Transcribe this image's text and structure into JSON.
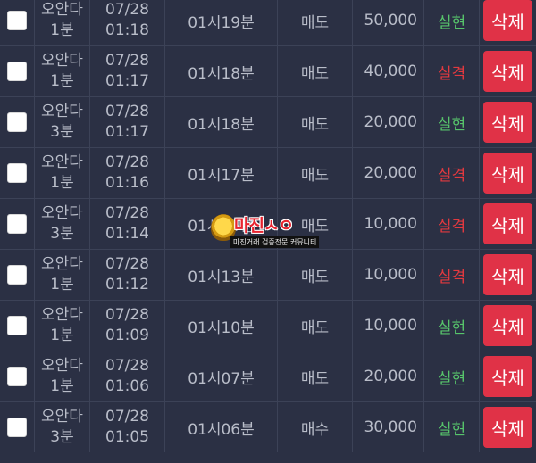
{
  "delete_label": "삭제",
  "colors": {
    "background": "#2b3044",
    "delete_button": "#e03247",
    "result_success": "#57c46b",
    "result_fail": "#e2393f"
  },
  "rows": [
    {
      "game": "오안다",
      "interval": "1분",
      "date": "07/28",
      "time": "01:18",
      "round": "01시19분",
      "type": "매도",
      "amount": "50,000",
      "result": "실현",
      "status": "success"
    },
    {
      "game": "오안다",
      "interval": "1분",
      "date": "07/28",
      "time": "01:17",
      "round": "01시18분",
      "type": "매도",
      "amount": "40,000",
      "result": "실격",
      "status": "fail"
    },
    {
      "game": "오안다",
      "interval": "3분",
      "date": "07/28",
      "time": "01:17",
      "round": "01시18분",
      "type": "매도",
      "amount": "20,000",
      "result": "실현",
      "status": "success"
    },
    {
      "game": "오안다",
      "interval": "1분",
      "date": "07/28",
      "time": "01:16",
      "round": "01시17분",
      "type": "매도",
      "amount": "20,000",
      "result": "실격",
      "status": "fail"
    },
    {
      "game": "오안다",
      "interval": "3분",
      "date": "07/28",
      "time": "01:14",
      "round": "01시15분",
      "type": "매도",
      "amount": "10,000",
      "result": "실격",
      "status": "fail"
    },
    {
      "game": "오안다",
      "interval": "1분",
      "date": "07/28",
      "time": "01:12",
      "round": "01시13분",
      "type": "매도",
      "amount": "10,000",
      "result": "실격",
      "status": "fail"
    },
    {
      "game": "오안다",
      "interval": "1분",
      "date": "07/28",
      "time": "01:09",
      "round": "01시10분",
      "type": "매도",
      "amount": "10,000",
      "result": "실현",
      "status": "success"
    },
    {
      "game": "오안다",
      "interval": "1분",
      "date": "07/28",
      "time": "01:06",
      "round": "01시07분",
      "type": "매도",
      "amount": "20,000",
      "result": "실현",
      "status": "success"
    },
    {
      "game": "오안다",
      "interval": "3분",
      "date": "07/28",
      "time": "01:05",
      "round": "01시06분",
      "type": "매수",
      "amount": "30,000",
      "result": "실현",
      "status": "success"
    }
  ],
  "watermark": {
    "title": "마진ㅅㅇ",
    "subtitle": "마진거래 검증전문 커뮤니티"
  }
}
